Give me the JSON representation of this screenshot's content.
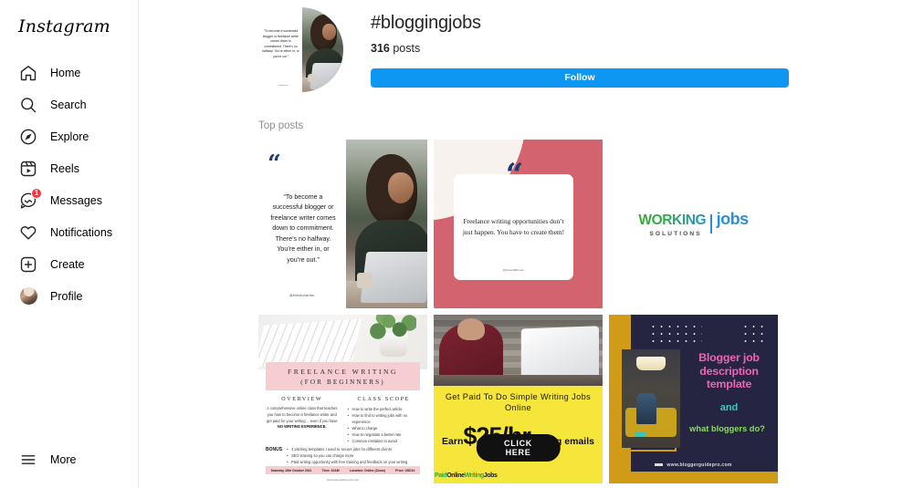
{
  "sidebar": {
    "brand": "Instagram",
    "items": [
      {
        "label": "Home",
        "icon": "home-icon"
      },
      {
        "label": "Search",
        "icon": "search-icon"
      },
      {
        "label": "Explore",
        "icon": "compass-icon"
      },
      {
        "label": "Reels",
        "icon": "reels-icon"
      },
      {
        "label": "Messages",
        "icon": "messenger-icon",
        "badge": "1"
      },
      {
        "label": "Notifications",
        "icon": "heart-icon"
      },
      {
        "label": "Create",
        "icon": "plus-square-icon"
      },
      {
        "label": "Profile",
        "icon": "avatar-icon"
      }
    ],
    "more_label": "More"
  },
  "header": {
    "hashtag": "#bloggingjobs",
    "post_count": "316",
    "post_count_suffix": " posts",
    "follow_label": "Follow",
    "follow_color": "#0d96f2"
  },
  "section": {
    "top_posts_label": "Top posts"
  },
  "posts": [
    {
      "name": "quote-post-commitment",
      "quote_mark": "“",
      "text": "“To become a successful blogger or freelance writer comes down to commitment. There’s no halfway. You’re either in, or you’re out.”",
      "credit": "@blissfullwriter",
      "accent": "#1f3f7a"
    },
    {
      "name": "quote-post-opportunities",
      "quote_mark": "“",
      "text": "Freelance writing opportunities don’t just happen. You have to create them!",
      "credit": "@HannahBonner",
      "accent": "#1b3b72",
      "blob_color": "#d2636f"
    },
    {
      "name": "working-solutions-logo-post",
      "brand_main": "WORKING",
      "brand_registered": "®",
      "brand_sub": "SOLUTIONS",
      "brand_right": "jobs",
      "color_green": "#3aa935",
      "color_blue": "#2f8fd6"
    },
    {
      "name": "freelance-writing-class-flyer",
      "band_line1": "FREELANCE WRITING",
      "band_line2": "(FOR BEGINNERS)",
      "col1_head": "OVERVIEW",
      "col1_body": "A comprehensive online class that teaches you how to become a freelance writer and get paid for your writing… even if you have ",
      "col1_body_bold": "NO WRITING EXPERIENCE.",
      "col2_head": "CLASS SCOPE",
      "col2_items": [
        "How to write the perfect article",
        "How to find to writing jobs with no experience",
        "What to charge",
        "How to negotiate a better rate",
        "Common mistakes to avoid"
      ],
      "bonus_label": "BONUS",
      "bonus_items": [
        "4 pitching templates I used to secure jobs for different clients",
        "SEO training so you can charge more",
        "Paid writing opportunity with free training and feedback on your writing"
      ],
      "footer_date": "Saturday 16th October 2021",
      "footer_time": "Time: 10AM",
      "footer_location": "Location: Online (Zoom)",
      "footer_price": "Price: USD10",
      "url": "www.ask.andbeyond.com",
      "band_color": "#f6cdd1"
    },
    {
      "name": "paid-writing-jobs-ad",
      "headline": "Get Paid To Do Simple Writing Jobs Online",
      "earn_label": "Earn",
      "price": "$25/hr",
      "tail": "writing emails",
      "cta_label": "CLICK HERE",
      "brand_part1": "Paid",
      "brand_part2": "Online",
      "brand_part3": "Writing",
      "brand_part4": "Jobs",
      "bg_color": "#f6e63c"
    },
    {
      "name": "blogger-job-description-post",
      "title": "Blogger job description template",
      "connector": "and",
      "subtitle": "what bloggers do?",
      "url": "www.bloggerguidepro.com",
      "bg_color": "#252542",
      "gold_color": "#d09b17",
      "title_color": "#ee64b4",
      "connector_color": "#3ec7c0",
      "subtitle_color": "#8fd96a"
    }
  ]
}
